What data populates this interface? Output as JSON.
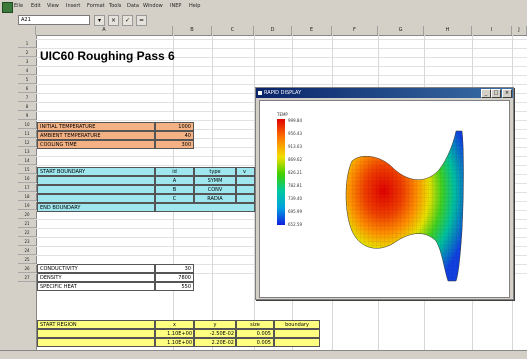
{
  "menu": [
    "Eile",
    "Edit",
    "View",
    "Insert",
    "Format",
    "Tools",
    "Data",
    "Window",
    "INEP",
    "Help"
  ],
  "namebox": "A21",
  "columns": [
    "A",
    "B",
    "C",
    "D",
    "E",
    "F",
    "G",
    "H",
    "I",
    "J"
  ],
  "rows": [
    "1",
    "2",
    "3",
    "4",
    "5",
    "6",
    "7",
    "8",
    "9",
    "10",
    "11",
    "12",
    "13",
    "14",
    "15",
    "16",
    "17",
    "18",
    "19",
    "20",
    "21",
    "22",
    "23",
    "24",
    "25",
    "26",
    "27"
  ],
  "title": "UIC60 Roughing Pass 6",
  "params": [
    {
      "label": "INITIAL TEMPERATURE",
      "value": "1000"
    },
    {
      "label": "AMBIENT TEMPERATURE",
      "value": "40"
    },
    {
      "label": "COOLING TIME",
      "value": "300"
    }
  ],
  "boundary": {
    "start": "START BOUNDARY",
    "id_header": "id",
    "type_header": "type",
    "extra_header": "v",
    "rows": [
      {
        "id": "A",
        "type": "SYMM"
      },
      {
        "id": "B",
        "type": "CONV"
      },
      {
        "id": "C",
        "type": "RADIA"
      }
    ],
    "end": "END BOUNDARY"
  },
  "material": [
    {
      "label": "CONDUCTIVITY",
      "value": "30"
    },
    {
      "label": "DENSITY",
      "value": "7800"
    },
    {
      "label": "SPECIFIC HEAT",
      "value": "550"
    }
  ],
  "region": {
    "start": "START REGION",
    "headers": [
      "x",
      "y",
      "size",
      "boundary"
    ],
    "rows": [
      [
        "1.10E+00",
        "-2.50E-02",
        "0.005",
        ""
      ],
      [
        "1.10E+00",
        "2.20E-02",
        "0.005",
        ""
      ]
    ]
  },
  "rapid_display": {
    "title": "RAPID DISPLAY",
    "legend_title": "TEMP",
    "legend_values": [
      "999.84",
      "956.43",
      "913.03",
      "869.62",
      "826.21",
      "782.81",
      "739.40",
      "695.99",
      "652.59"
    ],
    "buttons": [
      "_",
      "□",
      "×"
    ]
  }
}
